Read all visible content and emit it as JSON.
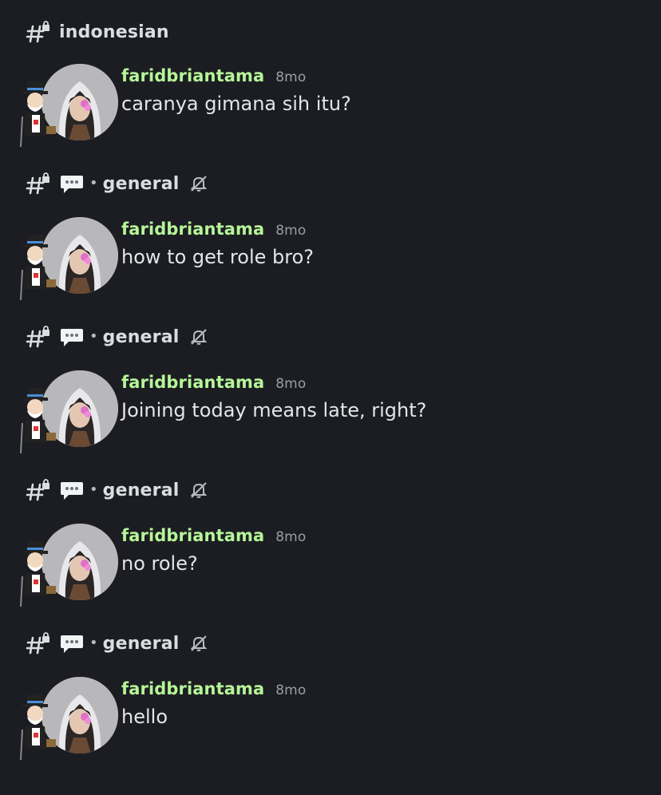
{
  "channels": [
    {
      "name": "indonesian",
      "has_bubble": false,
      "muted": false
    },
    {
      "name": "general",
      "has_bubble": true,
      "muted": true
    },
    {
      "name": "general",
      "has_bubble": true,
      "muted": true
    },
    {
      "name": "general",
      "has_bubble": true,
      "muted": true
    },
    {
      "name": "general",
      "has_bubble": true,
      "muted": true
    }
  ],
  "separator": "•",
  "messages": [
    {
      "username": "faridbriantama",
      "time": "8mo",
      "text": "caranya gimana sih itu?"
    },
    {
      "username": "faridbriantama",
      "time": "8mo",
      "text": "how to get role bro?"
    },
    {
      "username": "faridbriantama",
      "time": "8mo",
      "text": "Joining today means late, right?"
    },
    {
      "username": "faridbriantama",
      "time": "8mo",
      "text": "no role?"
    },
    {
      "username": "faridbriantama",
      "time": "8mo",
      "text": "hello"
    }
  ],
  "colors": {
    "background": "#1c1d22",
    "username": "#b6f598",
    "text": "#e3e5e8",
    "muted_text": "#9a9ea6"
  },
  "icons": {
    "channel": "locked-hash-icon",
    "thread": "speech-bubble-icon",
    "mute": "bell-slash-icon"
  }
}
